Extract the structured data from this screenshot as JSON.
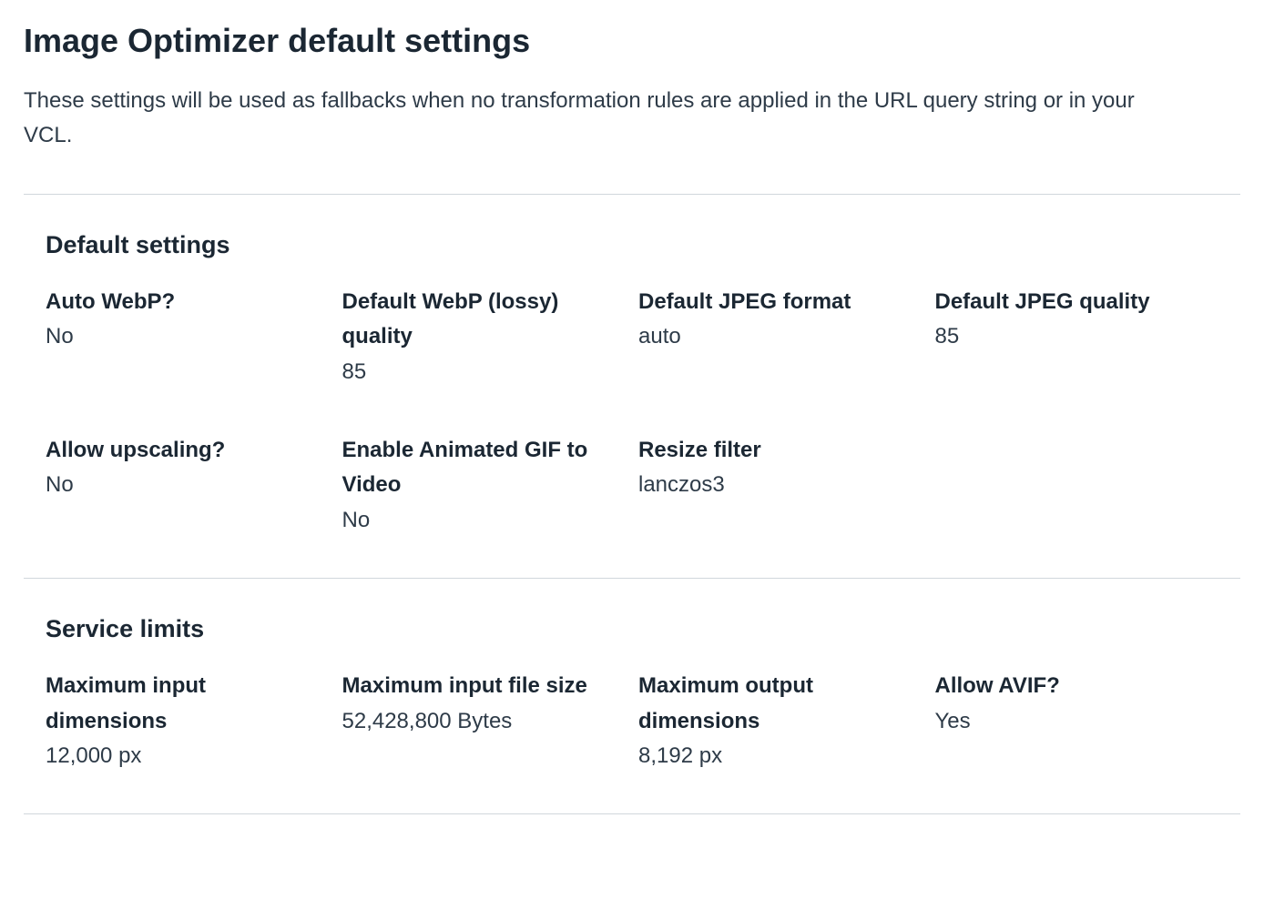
{
  "header": {
    "title": "Image Optimizer default settings",
    "description": "These settings will be used as fallbacks when no transformation rules are applied in the URL query string or in your VCL."
  },
  "sections": {
    "default": {
      "title": "Default settings",
      "items": [
        {
          "label": "Auto WebP?",
          "value": "No"
        },
        {
          "label": "Default WebP (lossy) quality",
          "value": "85"
        },
        {
          "label": "Default JPEG format",
          "value": "auto"
        },
        {
          "label": "Default JPEG quality",
          "value": "85"
        },
        {
          "label": "Allow upscaling?",
          "value": "No"
        },
        {
          "label": "Enable Animated GIF to Video",
          "value": "No"
        },
        {
          "label": "Resize filter",
          "value": "lanczos3"
        }
      ]
    },
    "limits": {
      "title": "Service limits",
      "items": [
        {
          "label": "Maximum input dimensions",
          "value": "12,000 px"
        },
        {
          "label": "Maximum input file size",
          "value": "52,428,800 Bytes"
        },
        {
          "label": "Maximum output dimensions",
          "value": "8,192 px"
        },
        {
          "label": "Allow AVIF?",
          "value": "Yes"
        }
      ]
    }
  }
}
